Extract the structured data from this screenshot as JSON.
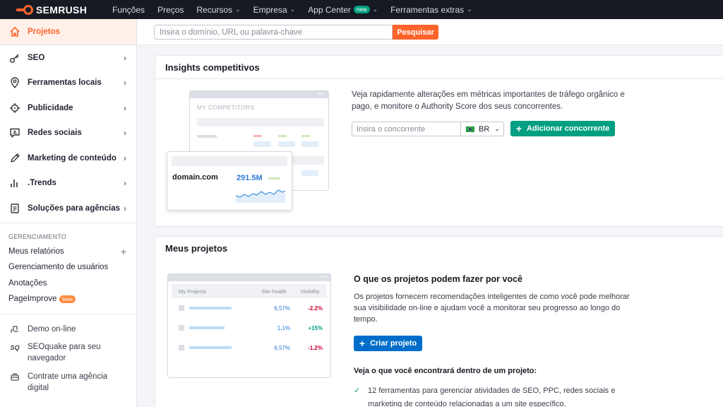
{
  "brand": {
    "name": "SEMRUSH",
    "accent": "#ff642d"
  },
  "topnav": [
    {
      "label": "Funções",
      "dropdown": false
    },
    {
      "label": "Preços",
      "dropdown": false
    },
    {
      "label": "Recursos",
      "dropdown": true
    },
    {
      "label": "Empresa",
      "dropdown": true
    },
    {
      "label": "App Center",
      "badge": "new",
      "dropdown": true
    },
    {
      "label": "Ferramentas extras",
      "dropdown": true
    }
  ],
  "sidebar": {
    "items": [
      {
        "label": "Projetos",
        "icon": "home-icon",
        "active": true
      },
      {
        "label": "SEO",
        "icon": "key-icon"
      },
      {
        "label": "Ferramentas locais",
        "icon": "location-pin-icon"
      },
      {
        "label": "Publicidade",
        "icon": "target-icon"
      },
      {
        "label": "Redes sociais",
        "icon": "social-chat-icon"
      },
      {
        "label": "Marketing de conteúdo",
        "icon": "pencil-icon"
      },
      {
        "label": ".Trends",
        "icon": "trends-bars-icon"
      },
      {
        "label": "Soluções para agências",
        "icon": "document-icon"
      }
    ],
    "management_title": "GERENCIAMENTO",
    "management": [
      {
        "label": "Meus relatórios",
        "plus": true
      },
      {
        "label": "Gerenciamento de usuários"
      },
      {
        "label": "Anotações"
      },
      {
        "label": "PageImprove",
        "badge": "beta"
      }
    ],
    "extras": [
      {
        "label": "Demo on-line",
        "icon": "demo-icon"
      },
      {
        "label": "SEOquake para seu navegador",
        "icon": "seoquake-icon"
      },
      {
        "label": "Contrate uma agência digital",
        "icon": "agency-icon"
      }
    ]
  },
  "search": {
    "placeholder": "Insira o domínio, URL ou palavra-chave",
    "button": "Pesquisar"
  },
  "insights": {
    "title": "Insights competitivos",
    "illustration": {
      "label": "MY COMPETITORS",
      "domain": "domain.com",
      "value": "291.5M"
    },
    "description": "Veja rapidamente alterações em métricas importantes de tráfego orgânico e pago, e monitore o Authority Score dos seus concorrentes.",
    "input_placeholder": "Insira o concorrente",
    "country": "BR",
    "add_button": "Adicionar concorrente"
  },
  "projects": {
    "title": "Meus projetos",
    "illustration": {
      "headers": [
        "My Projects",
        "Site health",
        "Visibility"
      ],
      "rows": [
        {
          "health": "6,57%",
          "visibility": "-2.2%"
        },
        {
          "health": "1,1%",
          "visibility": "+15%"
        },
        {
          "health": "6,57%",
          "visibility": "-1.2%"
        }
      ]
    },
    "heading": "O que os projetos podem fazer por você",
    "description": "Os projetos fornecem recomendações inteligentes de como você pode melhorar sua visibilidade on-line e ajudam você a monitorar seu progresso ao longo do tempo.",
    "create_button": "Criar projeto",
    "subheading": "Veja o que você encontrará dentro de um projeto:",
    "features": [
      "12 ferramentas para gerenciar atividades de SEO, PPC, redes sociais e marketing de conteúdo relacionadas a um site específico."
    ]
  }
}
